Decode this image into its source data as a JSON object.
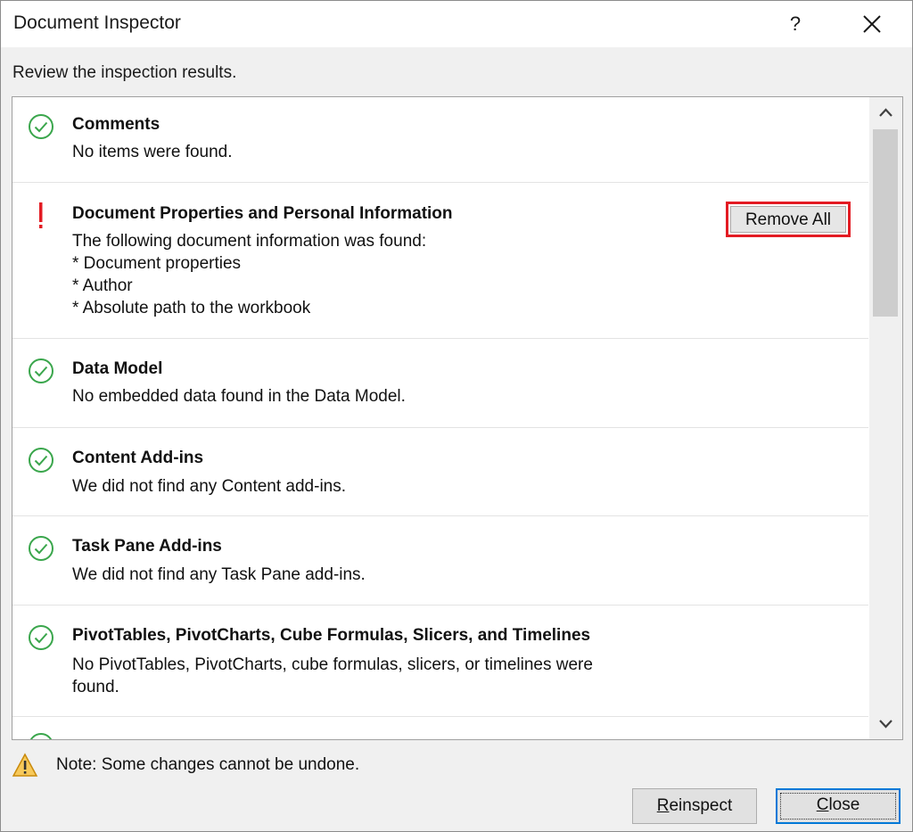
{
  "dialog": {
    "title": "Document Inspector",
    "help_label": "?",
    "subtitle": "Review the inspection results."
  },
  "results": [
    {
      "status": "passed",
      "title": "Comments",
      "description": "No items were found."
    },
    {
      "status": "issue",
      "title": "Document Properties and Personal Information",
      "description": "The following document information was found:\n* Document properties\n* Author\n* Absolute path to the workbook",
      "action_label": "Remove All"
    },
    {
      "status": "passed",
      "title": "Data Model",
      "description": "No embedded data found in the Data Model."
    },
    {
      "status": "passed",
      "title": "Content Add-ins",
      "description": "We did not find any Content add-ins."
    },
    {
      "status": "passed",
      "title": "Task Pane Add-ins",
      "description": "We did not find any Task Pane add-ins."
    },
    {
      "status": "passed",
      "title": "PivotTables, PivotCharts, Cube Formulas, Slicers, and Timelines",
      "description": "No PivotTables, PivotCharts, cube formulas, slicers, or timelines were\nfound."
    }
  ],
  "footer": {
    "note": "Note: Some changes cannot be undone.",
    "reinspect_mnemonic": "R",
    "reinspect_rest": "einspect",
    "close_mnemonic": "C",
    "close_rest": "lose"
  },
  "colors": {
    "passed": "#3aa64c",
    "issue": "#e31b23",
    "warning": "#f2b630",
    "highlight": "#e31b23",
    "focus": "#0078d7"
  },
  "icons": {
    "passed": "check-circle-icon",
    "issue": "exclamation-icon",
    "warning": "warning-triangle-icon"
  }
}
